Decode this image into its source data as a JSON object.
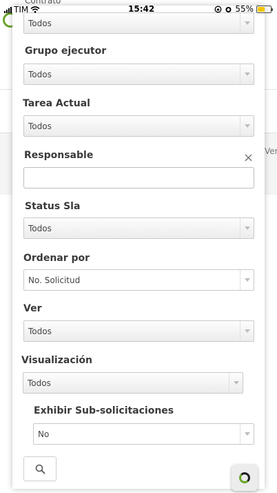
{
  "status_bar": {
    "carrier": "TIM",
    "time": "15:42",
    "battery": "55%",
    "battery_level": 0.55
  },
  "background": {
    "header_partial": "Contrato",
    "edge_text": "Ver"
  },
  "filters": {
    "first_select": {
      "value": "Todos"
    },
    "grupo_ejecutor": {
      "label": "Grupo ejecutor",
      "value": "Todos"
    },
    "tarea_actual": {
      "label": "Tarea Actual",
      "value": "Todos"
    },
    "responsable": {
      "label": "Responsable",
      "value": "",
      "clear_symbol": "×"
    },
    "status_sla": {
      "label": "Status Sla",
      "value": "Todos"
    },
    "ordenar_por": {
      "label": "Ordenar por",
      "value": "No. Solicitud"
    },
    "ver": {
      "label": "Ver",
      "value": "Todos"
    },
    "visualizacion": {
      "label": "Visualización",
      "value": "Todos"
    },
    "exhibir_sub": {
      "label": "Exhibir Sub-solicitaciones",
      "value": "No"
    }
  },
  "colors": {
    "brand_green": "#6aa52a",
    "battery_yellow": "#f5c400"
  },
  "icons": {
    "search": "search-icon",
    "clear": "close-icon",
    "dropdown": "chevron-down-icon",
    "floating": "app-logo-icon"
  }
}
